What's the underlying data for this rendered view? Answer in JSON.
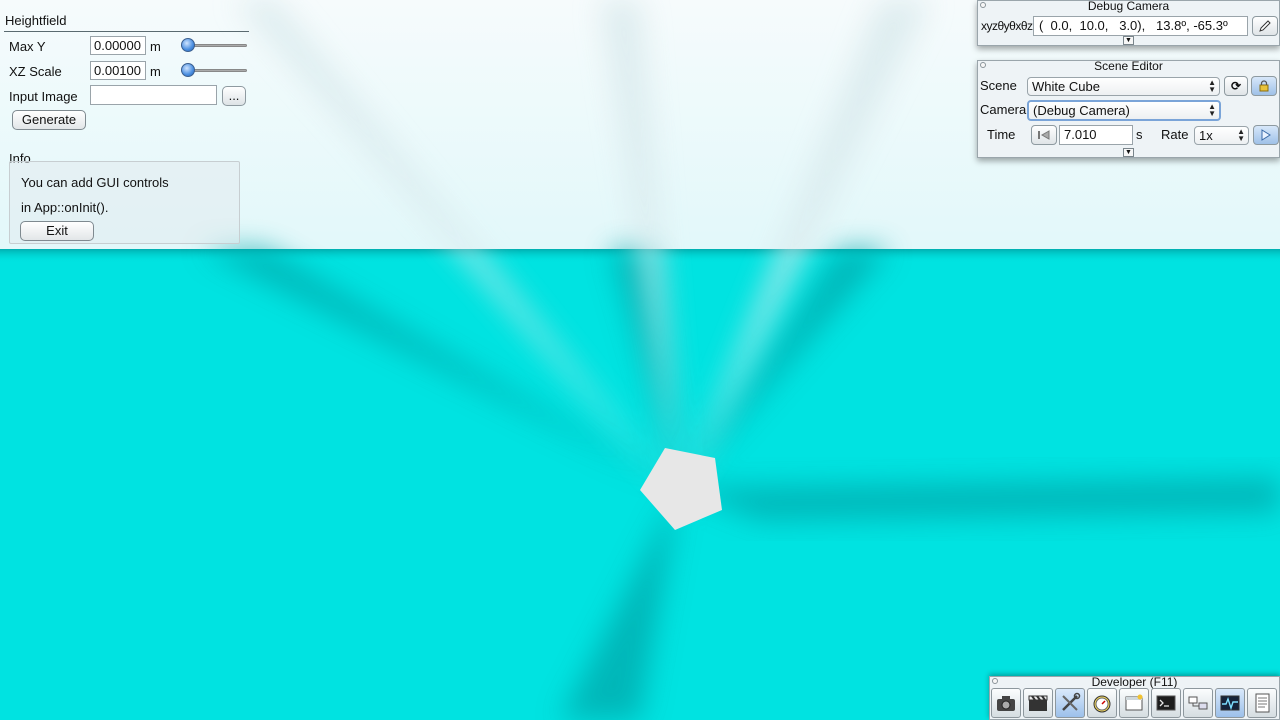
{
  "heightfield": {
    "title": "Heightfield",
    "max_y": {
      "label": "Max Y",
      "value": "0.00000",
      "unit": "m",
      "slider_level": 0.0
    },
    "xz_scale": {
      "label": "XZ Scale",
      "value": "0.00100",
      "unit": "m",
      "slider_level": 0.0
    },
    "input_image": {
      "label": "Input Image",
      "value": "",
      "browse_label": "..."
    },
    "generate_label": "Generate",
    "info": {
      "label": "Info",
      "line1": "You can add GUI controls",
      "line2": "in App::onInit().",
      "exit_label": "Exit"
    }
  },
  "debug_camera": {
    "title": "Debug Camera",
    "coord_label": "xyzθyθxθz",
    "coord_value": "(  0.0,  10.0,   3.0),   13.8º, -65.3º"
  },
  "scene_editor": {
    "title": "Scene Editor",
    "scene_label": "Scene",
    "scene_value": "White Cube",
    "camera_label": "Camera",
    "camera_value": "(Debug Camera)",
    "time_label": "Time",
    "time_value": "7.010",
    "time_unit": "s",
    "rate_label": "Rate",
    "rate_value": "1x"
  },
  "developer": {
    "title": "Developer (F11)",
    "tools": [
      "camera-icon",
      "clapperboard-icon",
      "wrench-screwdriver-icon",
      "stopwatch-icon",
      "new-window-icon",
      "terminal-icon",
      "scene-graph-icon",
      "profiler-icon",
      "document-icon"
    ]
  },
  "colors": {
    "sky": "#f3fbfc",
    "ground": "#00e3e1",
    "accent": "#4a8ee0"
  }
}
